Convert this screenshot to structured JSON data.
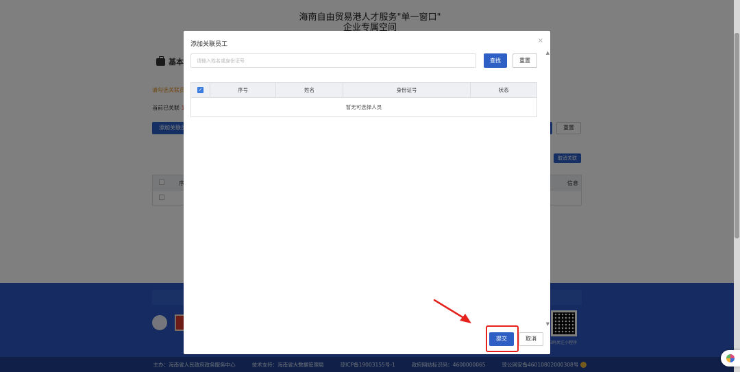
{
  "background": {
    "site_title": "海南自由贸易港人才服务\"单一窗口\"",
    "site_subtitle": "企业专属空间",
    "section_title": "基本",
    "warn_text": "请勾选关联员",
    "current_text_prefix": "当前已关联 ",
    "current_count": "1",
    "add_button": "添加关联员",
    "reset_button": "重置",
    "cancel_link_button": "取消关联",
    "table_header_seq": "序",
    "table_header_info": "信息",
    "qr_label": "扫码关注小程序",
    "footer": {
      "host": "主办：海南省人民政府政务服务中心",
      "tech": "技术支持：海南省大数据管理局",
      "icp": "琼ICP备19003155号-1",
      "gov_code": "政府网站标识码：4600000065",
      "police": "琼公网安备46010802000308号"
    }
  },
  "modal": {
    "title": "添加关联员工",
    "close_symbol": "×",
    "search": {
      "placeholder": "请输入姓名或身份证号",
      "value": ""
    },
    "search_button": "查找",
    "reset_button": "重置",
    "table": {
      "check_symbol": "✓",
      "columns": [
        "序号",
        "姓名",
        "身份证号",
        "状态"
      ],
      "rows": [],
      "empty_text": "暂无可选择人员"
    },
    "submit_button": "提交",
    "cancel_button": "取消"
  },
  "colors": {
    "primary": "#2d5fc4",
    "annotation": "#e4211c",
    "warning": "#e08a1e",
    "footer": "#2b57c2"
  }
}
